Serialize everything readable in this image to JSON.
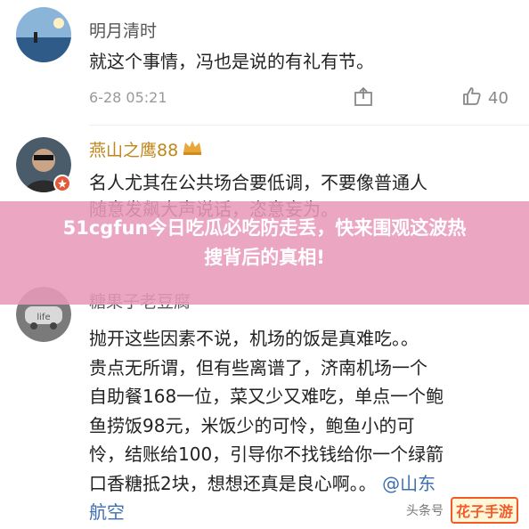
{
  "comments": [
    {
      "user": "明月清时",
      "text": "就这个事情，冯也是说的有礼有节。",
      "date": "6-28 05:21",
      "likes": "40"
    },
    {
      "user": "燕山之鹰88",
      "text_lines": [
        "名人尤其在公共场合要低调，不要像普通人",
        "随意发飙大声说话，恣意妄为。"
      ]
    },
    {
      "user": "糖果子老豆腐",
      "avatar_text": "life",
      "text_lines": [
        "抛开这些因素不说，机场的饭是真难吃。。",
        "贵点无所谓，但有些离谱了，济南机场一个",
        "自助餐168一位，菜又少又难吃，单点一个鲍",
        "鱼捞饭98元，米饭少的可怜，鲍鱼小的可",
        "怜，结账给100，引导你不找钱给你一个绿箭",
        "口香糖抵2块，想想还真是良心啊。。"
      ],
      "mention_lines": [
        "@山东",
        "航空"
      ]
    }
  ],
  "overlay": {
    "headline_line1": "51cgfun今日吃瓜必吃防走丢，快来围观这波热",
    "headline_line2": "搜背后的真相!"
  },
  "watermark": {
    "source": "头条号",
    "brand": "花子手游"
  },
  "icons": [
    "crown-icon",
    "badge-icon",
    "share-icon",
    "like-icon"
  ],
  "colors": {
    "banner": "#e89aba",
    "vip_name": "#c0861a",
    "link": "#3d6fb0",
    "brand": "#f25a2a"
  }
}
